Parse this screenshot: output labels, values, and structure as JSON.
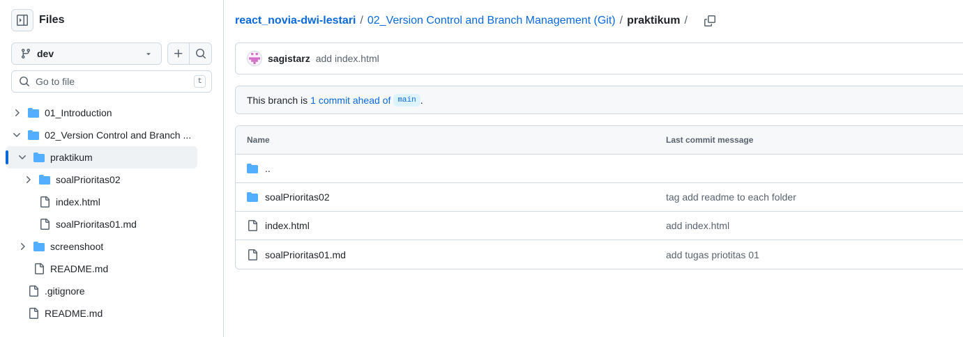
{
  "sidebar": {
    "title": "Files",
    "branch": "dev",
    "search_placeholder": "Go to file",
    "search_shortcut": "t",
    "tree": [
      {
        "label": "01_Introduction",
        "type": "folder",
        "depth": 1,
        "expanded": false,
        "active": false
      },
      {
        "label": "02_Version Control and Branch ...",
        "type": "folder",
        "depth": 1,
        "expanded": true,
        "active": false
      },
      {
        "label": "praktikum",
        "type": "folder",
        "depth": 2,
        "expanded": true,
        "active": true
      },
      {
        "label": "soalPrioritas02",
        "type": "folder",
        "depth": 3,
        "expanded": false,
        "active": false
      },
      {
        "label": "index.html",
        "type": "file",
        "depth": 3,
        "active": false
      },
      {
        "label": "soalPrioritas01.md",
        "type": "file",
        "depth": 3,
        "active": false
      },
      {
        "label": "screenshoot",
        "type": "folder",
        "depth": 2,
        "expanded": false,
        "active": false
      },
      {
        "label": "README.md",
        "type": "file",
        "depth": 2,
        "active": false
      },
      {
        "label": ".gitignore",
        "type": "file",
        "depth": 1,
        "active": false
      },
      {
        "label": "README.md",
        "type": "file",
        "depth": 1,
        "active": false
      }
    ]
  },
  "breadcrumb": {
    "repo": "react_novia-dwi-lestari",
    "separator": "/",
    "folder": "02_Version Control and Branch Management (Git)",
    "current": "praktikum",
    "trailing": "/"
  },
  "commit": {
    "author": "sagistarz",
    "message": "add index.html"
  },
  "branch_status": {
    "prefix": "This branch is",
    "link": "1 commit ahead of",
    "base": "main",
    "suffix": "."
  },
  "table": {
    "headers": {
      "name": "Name",
      "message": "Last commit message"
    },
    "rows": [
      {
        "name": "..",
        "type": "folder",
        "message": ""
      },
      {
        "name": "soalPrioritas02",
        "type": "folder",
        "message": "tag add readme to each folder"
      },
      {
        "name": "index.html",
        "type": "file",
        "message": "add index.html"
      },
      {
        "name": "soalPrioritas01.md",
        "type": "file",
        "message": "add tugas priotitas 01"
      }
    ]
  },
  "colors": {
    "link": "#0969da",
    "folder": "#54aeff",
    "border": "#d1d9e0",
    "active_indicator": "#0969da"
  }
}
